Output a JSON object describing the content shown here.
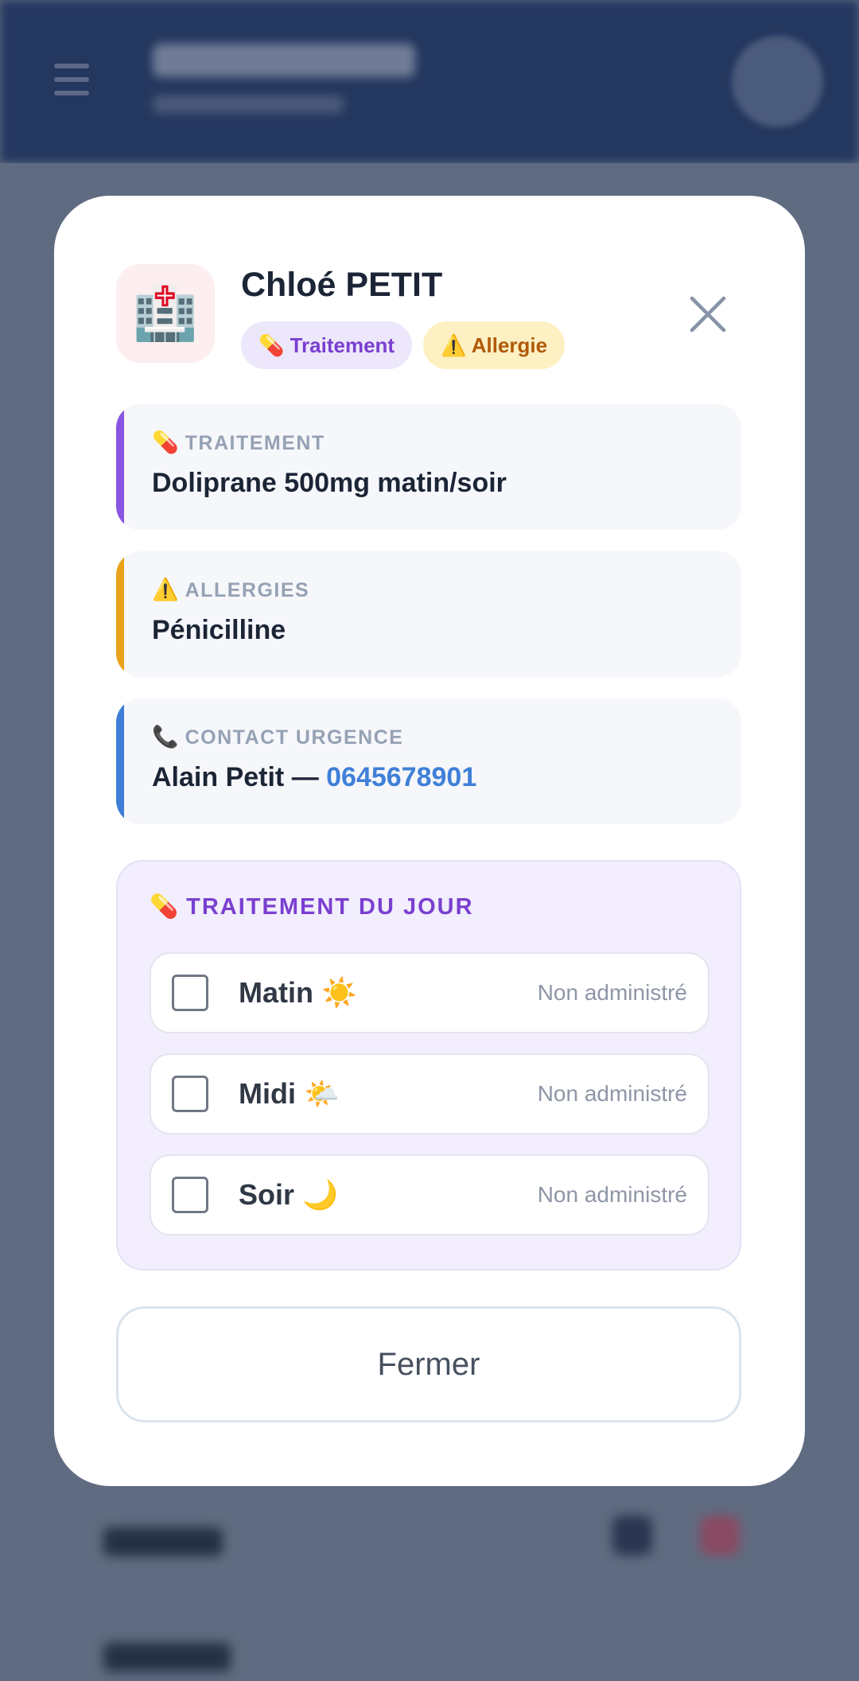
{
  "patient": {
    "name": "Chloé PETIT",
    "avatar_icon": "🏥",
    "badges": [
      {
        "icon": "💊",
        "label": "Traitement",
        "color": "#7a3fd0"
      },
      {
        "icon": "⚠️",
        "label": "Allergie",
        "color": "#b05a08"
      }
    ]
  },
  "info_cards": [
    {
      "icon": "💊",
      "label": "TRAITEMENT",
      "value": "Doliprane 500mg matin/soir",
      "accent": "#8a55e0"
    },
    {
      "icon": "⚠️",
      "label": "ALLERGIES",
      "value": "Pénicilline",
      "accent": "#e9a21a"
    },
    {
      "icon": "📞",
      "label": "CONTACT URGENCE",
      "value": "Alain Petit — ",
      "phone": "0645678901",
      "accent": "#3f7fd8"
    }
  ],
  "daily_treatment": {
    "icon": "💊",
    "title": "TRAITEMENT DU JOUR",
    "doses": [
      {
        "label": "Matin ☀️",
        "status": "Non administré",
        "checked": false
      },
      {
        "label": "Midi 🌤️",
        "status": "Non administré",
        "checked": false
      },
      {
        "label": "Soir 🌙",
        "status": "Non administré",
        "checked": false
      }
    ]
  },
  "close_button_label": "Fermer",
  "icons": {
    "close": "close-icon",
    "hospital": "hospital-icon"
  }
}
